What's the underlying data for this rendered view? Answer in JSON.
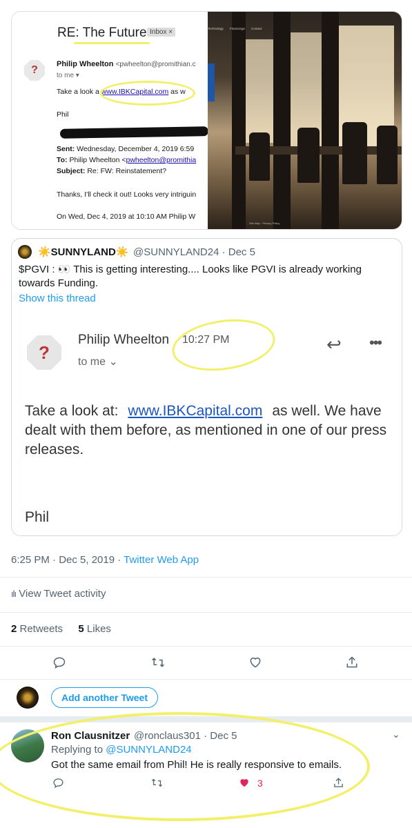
{
  "email_screenshot": {
    "subject": "RE: The Future",
    "inbox_chip": "Inbox ×",
    "sender_name": "Philip Wheelton",
    "sender_email": "<pwheelton@promithian.c",
    "to": "to me ▾",
    "body_prefix": "Take a look a",
    "body_link": "www.IBKCapital.com",
    "body_suffix": "as w",
    "signature": "Phil",
    "sent_label": "Sent:",
    "sent_value": "Wednesday, December 4, 2019 6:59",
    "to_label": "To:",
    "to_value": "Philip Wheelton <",
    "to_link": "pwheelton@promithia",
    "subject_label": "Subject:",
    "subject_value": "Re: FW: Reinstatement?",
    "thanks_line": "Thanks, I'll check it out! Looks very intriguin",
    "on_line": "On Wed, Dec 4, 2019 at 10:10 AM Philip W"
  },
  "photo": {
    "nav": "Technology Financings Contact",
    "footer": "Site Map  ·  Privacy Policy"
  },
  "quoted_tweet": {
    "name": "☀️SUNNYLAND☀️",
    "handle_date": "@SUNNYLAND24 · Dec 5",
    "text": "$PGVI : 👀 This is getting interesting.... Looks like PGVI is already working towards Funding.",
    "show_thread": "Show this thread"
  },
  "inner_email": {
    "name": "Philip Wheelton",
    "time": "10:27 PM",
    "to": "to me ⌄",
    "body_prefix": "Take a look at:",
    "body_link": "www.IBKCapital.com",
    "body_suffix": "as well. We have dealt with them before, as mentioned in one of our press releases.",
    "signature": "Phil"
  },
  "tweet_meta": {
    "timestamp": "6:25 PM · Dec 5, 2019 · ",
    "app": "Twitter Web App",
    "activity": "View Tweet activity",
    "retweets_count": "2",
    "retweets_label": " Retweets",
    "likes_count": "5",
    "likes_label": " Likes"
  },
  "add_tweet": {
    "button": "Add another Tweet"
  },
  "reply": {
    "name": "Ron Clausnitzer",
    "handle_date": "@ronclaus301 · Dec 5",
    "replying_prefix": "Replying to ",
    "replying_mention": "@SUNNYLAND24",
    "text": "Got the same email from Phil! He is really responsive to emails.",
    "like_count": "3"
  },
  "colors": {
    "highlight": "#f2ef6a",
    "twitter_blue": "#1d9bf0",
    "like_red": "#e0245e"
  }
}
